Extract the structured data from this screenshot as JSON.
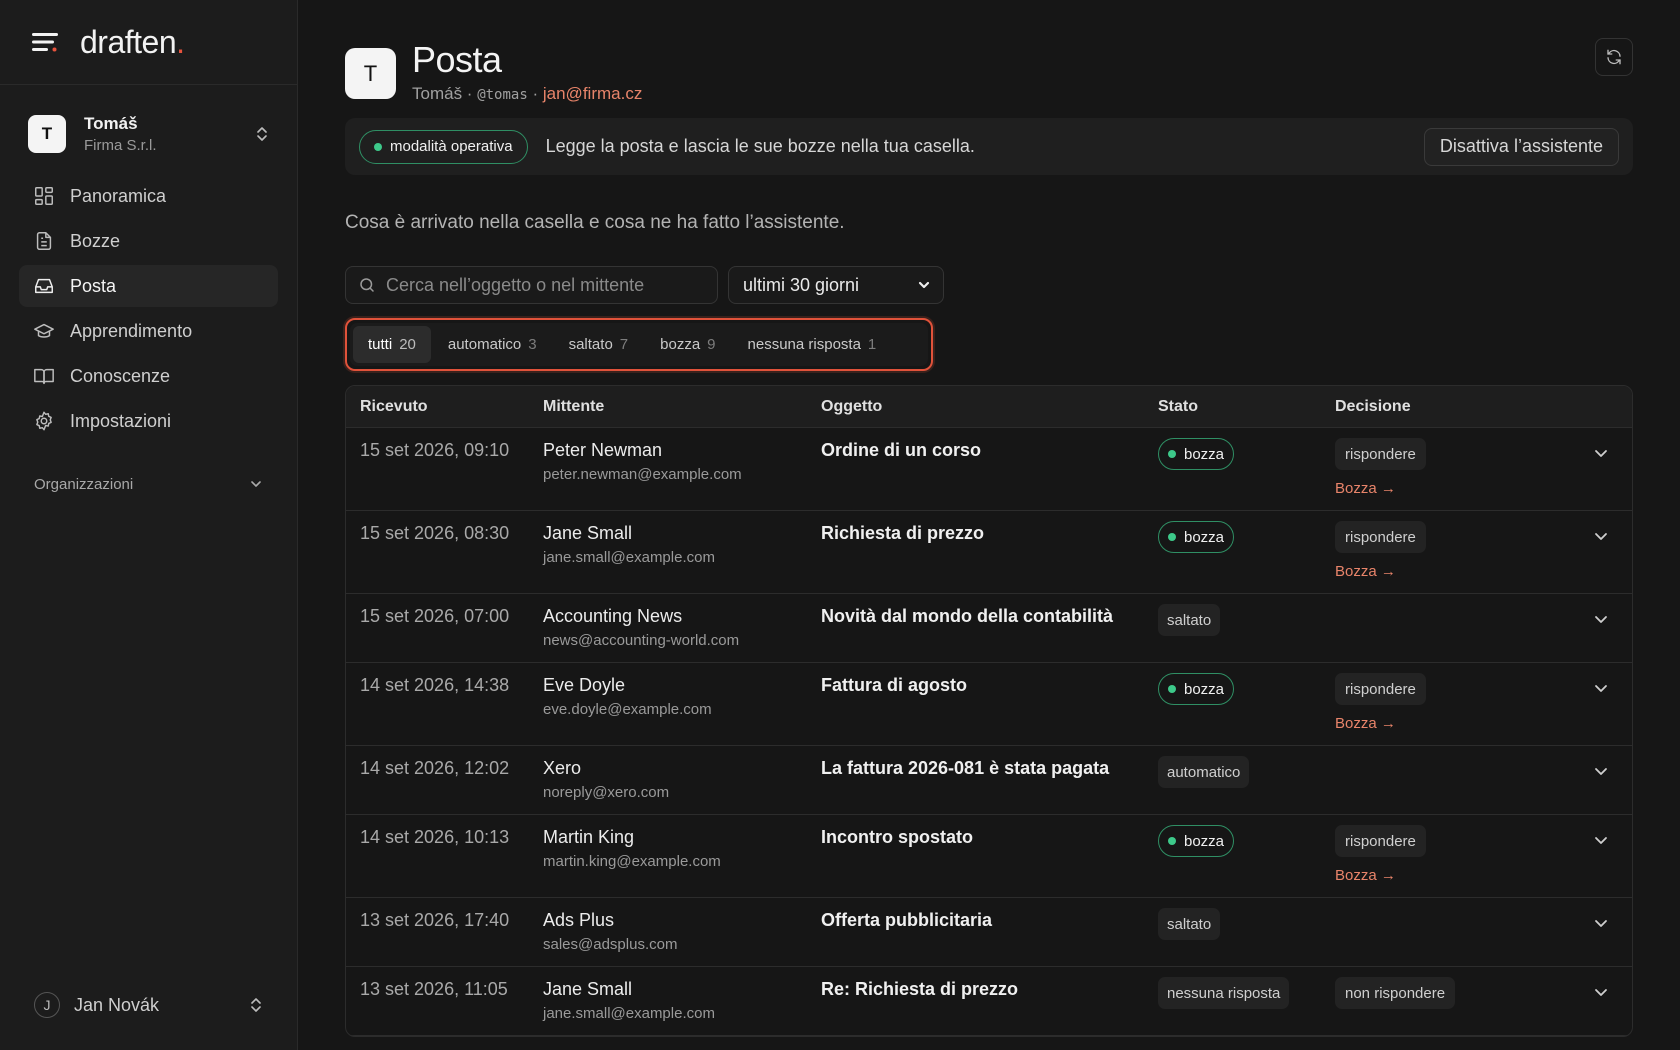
{
  "brand": {
    "name": "draften",
    "dot": "."
  },
  "org": {
    "initial": "T",
    "name": "Tomáš",
    "company": "Firma S.r.l."
  },
  "nav": [
    {
      "label": "Panoramica",
      "icon": "dashboard-icon"
    },
    {
      "label": "Bozze",
      "icon": "document-icon"
    },
    {
      "label": "Posta",
      "icon": "inbox-icon",
      "active": true
    },
    {
      "label": "Apprendimento",
      "icon": "graduation-cap-icon"
    },
    {
      "label": "Conoscenze",
      "icon": "book-icon"
    },
    {
      "label": "Impostazioni",
      "icon": "gear-icon"
    }
  ],
  "section_orgs": "Organizzazioni",
  "user": {
    "initial": "J",
    "name": "Jan Novák"
  },
  "page": {
    "avatar": "T",
    "title": "Posta",
    "name": "Tomáš",
    "sep1": " · ",
    "handle": "@tomas",
    "sep2": " · ",
    "email": "jan@firma.cz"
  },
  "banner": {
    "mode": "modalità operativa",
    "text": "Legge la posta e lascia le sue bozze nella tua casella.",
    "button": "Disattiva l’assistente"
  },
  "lede": "Cosa è arrivato nella casella e cosa ne ha fatto l’assistente.",
  "search": {
    "placeholder": "Cerca nell’oggetto o nel mittente"
  },
  "range": {
    "selected": "ultimi 30 giorni"
  },
  "segments": [
    {
      "label": "tutti",
      "count": "20",
      "active": true
    },
    {
      "label": "automatico",
      "count": "3"
    },
    {
      "label": "saltato",
      "count": "7"
    },
    {
      "label": "bozza",
      "count": "9"
    },
    {
      "label": "nessuna risposta",
      "count": "1"
    }
  ],
  "table": {
    "headers": {
      "received": "Ricevuto",
      "sender": "Mittente",
      "subject": "Oggetto",
      "status": "Stato",
      "decision": "Decisione"
    },
    "rows": [
      {
        "received": "15 set 2026, 09:10",
        "sender": "Peter Newman",
        "email": "peter.newman@example.com",
        "subject": "Ordine di un corso",
        "status": "bozza",
        "decision": "rispondere",
        "link": "Bozza →"
      },
      {
        "received": "15 set 2026, 08:30",
        "sender": "Jane Small",
        "email": "jane.small@example.com",
        "subject": "Richiesta di prezzo",
        "status": "bozza",
        "decision": "rispondere",
        "link": "Bozza →"
      },
      {
        "received": "15 set 2026, 07:00",
        "sender": "Accounting News",
        "email": "news@accounting-world.com",
        "subject": "Novità dal mondo della contabilità",
        "status": "saltato",
        "decision": "",
        "link": ""
      },
      {
        "received": "14 set 2026, 14:38",
        "sender": "Eve Doyle",
        "email": "eve.doyle@example.com",
        "subject": "Fattura di agosto",
        "status": "bozza",
        "decision": "rispondere",
        "link": "Bozza →"
      },
      {
        "received": "14 set 2026, 12:02",
        "sender": "Xero",
        "email": "noreply@xero.com",
        "subject": "La fattura 2026-081 è stata pagata",
        "status": "automatico",
        "decision": "",
        "link": ""
      },
      {
        "received": "14 set 2026, 10:13",
        "sender": "Martin King",
        "email": "martin.king@example.com",
        "subject": "Incontro spostato",
        "status": "bozza",
        "decision": "rispondere",
        "link": "Bozza →"
      },
      {
        "received": "13 set 2026, 17:40",
        "sender": "Ads Plus",
        "email": "sales@adsplus.com",
        "subject": "Offerta pubblicitaria",
        "status": "saltato",
        "decision": "",
        "link": ""
      },
      {
        "received": "13 set 2026, 11:05",
        "sender": "Jane Small",
        "email": "jane.small@example.com",
        "subject": "Re: Richiesta di prezzo",
        "status": "nessuna risposta",
        "decision": "non rispondere",
        "link": ""
      }
    ]
  },
  "colors": {
    "accent": "#e7533d",
    "link": "#e8846a",
    "status_green": "#3dc98a",
    "background": "#161616"
  }
}
